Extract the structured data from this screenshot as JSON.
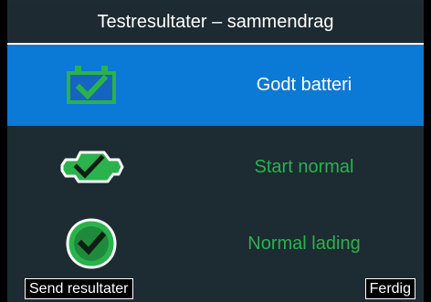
{
  "header": {
    "title": "Testresultater – sammendrag"
  },
  "results": [
    {
      "label": "Godt batteri",
      "icon": "battery-check-icon",
      "selected": true
    },
    {
      "label": "Start normal",
      "icon": "engine-check-icon",
      "selected": false
    },
    {
      "label": "Normal lading",
      "icon": "alternator-check-icon",
      "selected": false
    }
  ],
  "softkeys": {
    "send_label": "Send resultater",
    "done_label": "Ferdig"
  },
  "colors": {
    "selected_row": "#0b79d6",
    "ok_green": "#2bb24c",
    "background": "#1d2b33"
  }
}
